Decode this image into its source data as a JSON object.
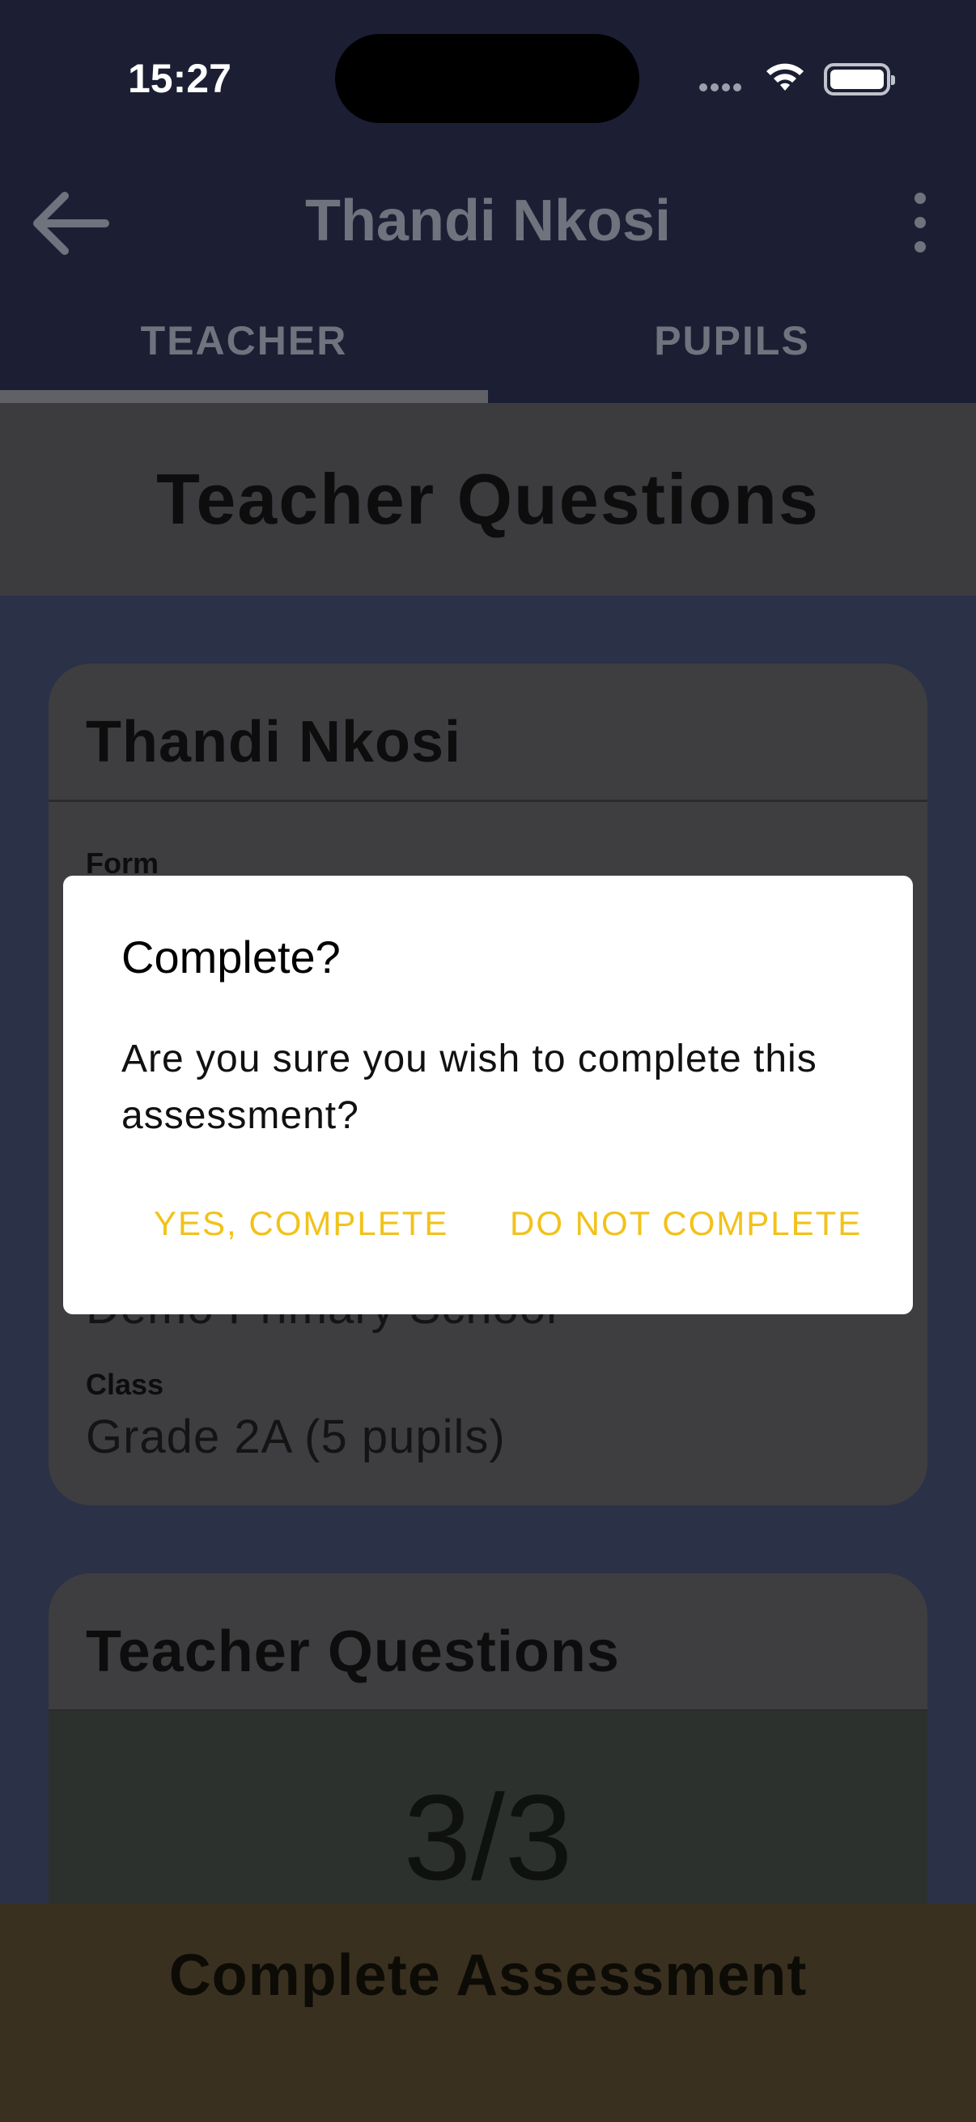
{
  "status_bar": {
    "time": "15:27"
  },
  "app_bar": {
    "title": "Thandi Nkosi"
  },
  "tabs": [
    {
      "label": "TEACHER",
      "selected": true
    },
    {
      "label": "PUPILS",
      "selected": false
    }
  ],
  "section_header": {
    "title": "Teacher Questions"
  },
  "info_card": {
    "title": "Thandi Nkosi",
    "fields": [
      {
        "label": "Form",
        "value": ""
      },
      {
        "label": "",
        "value": "Demo Primary School"
      },
      {
        "label": "Class",
        "value": "Grade 2A (5 pupils)"
      }
    ]
  },
  "questions_card": {
    "title": "Teacher Questions",
    "progress": "3/3"
  },
  "bottom_bar": {
    "label": "Complete Assessment"
  },
  "dialog": {
    "title": "Complete?",
    "message": "Are you sure you wish to complete this assessment?",
    "confirm_label": "YES, COMPLETE",
    "cancel_label": "DO NOT COMPLETE"
  },
  "colors": {
    "accent": "#f2c21a",
    "app_bar_bg": "#1c1f33",
    "scrim_bg": "#2b3147"
  },
  "icons": {
    "back": "arrow-left",
    "more": "more-vertical",
    "wifi": "wifi",
    "battery": "battery-full"
  }
}
